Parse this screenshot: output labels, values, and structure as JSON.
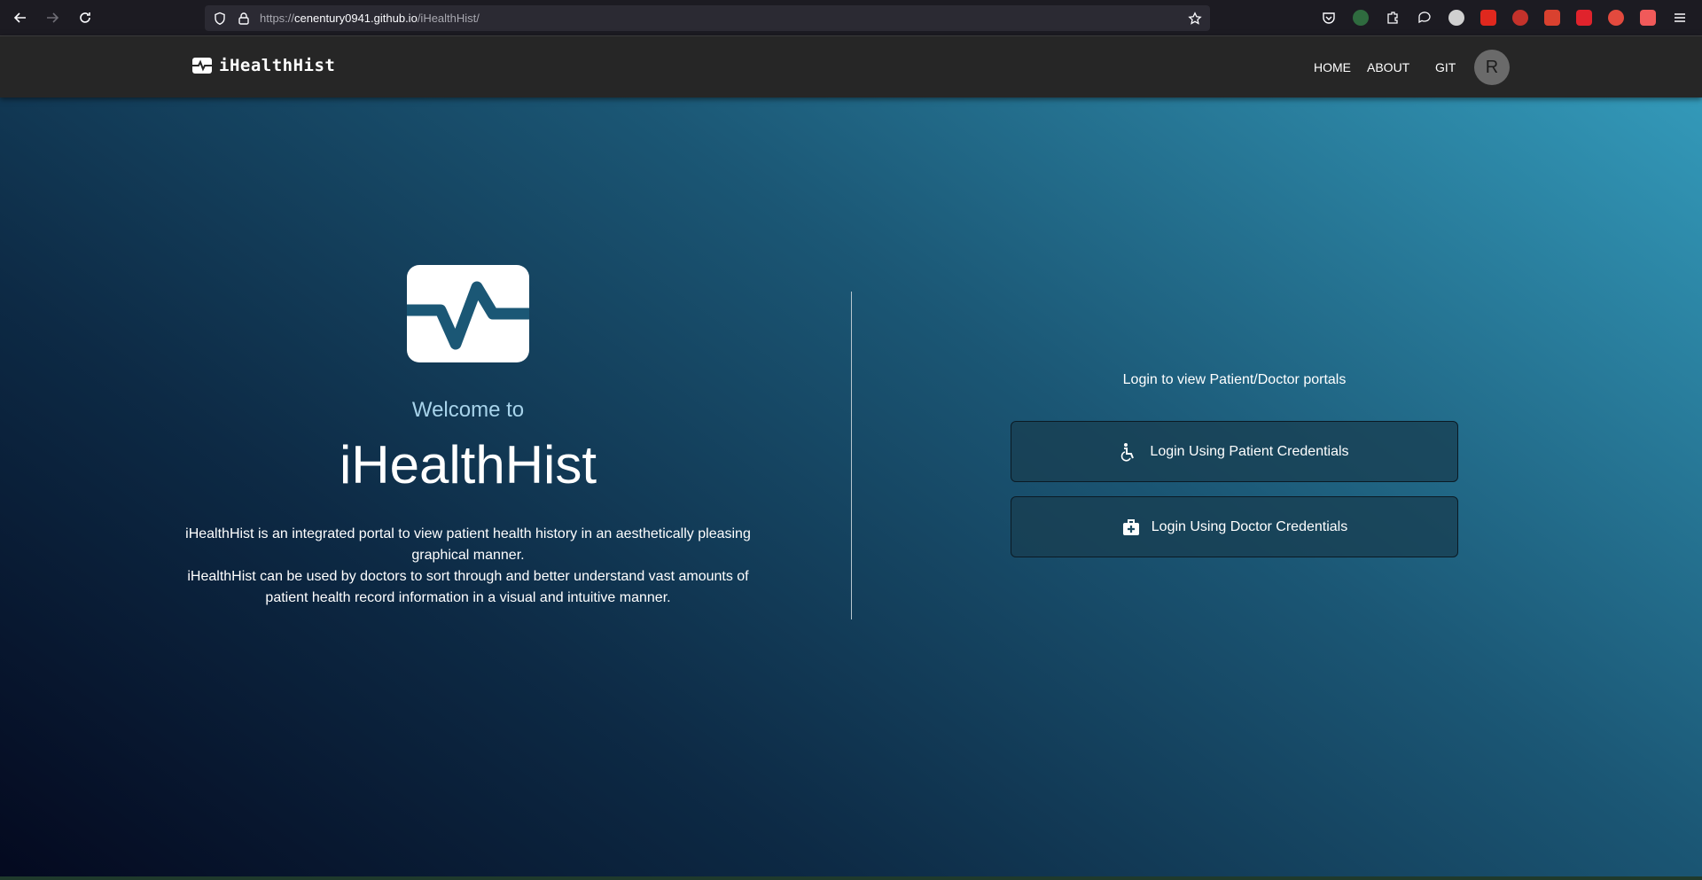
{
  "browser": {
    "url_prefix": "https://",
    "url_host": "cenentury0941.github.io",
    "url_path": "/iHealthHist/",
    "icons": [
      "back-icon",
      "forward-icon",
      "reload-icon",
      "shield-icon",
      "lock-icon",
      "star-icon",
      "pocket-icon",
      "extensions-icon",
      "menu-icon"
    ]
  },
  "navbar": {
    "brand": "iHealthHist",
    "links": [
      "HOME",
      "ABOUT",
      "GIT"
    ],
    "avatar_initial": "R"
  },
  "hero": {
    "welcome": "Welcome to",
    "title": "iHealthHist",
    "description_1": "iHealthHist is an integrated portal to view patient health history in an aesthetically pleasing graphical manner.",
    "description_2": "iHealthHist can be used by doctors to sort through and better understand vast amounts of patient health record information in a visual and intuitive manner."
  },
  "login": {
    "prompt": "Login to view Patient/Doctor portals",
    "patient_label": "Login Using Patient Credentials",
    "doctor_label": "Login Using Doctor Credentials"
  },
  "colors": {
    "navbar_bg": "#262626",
    "logo_accent": "#1b5775",
    "gradient_dark": "#04091f",
    "gradient_light": "#3399b9"
  }
}
